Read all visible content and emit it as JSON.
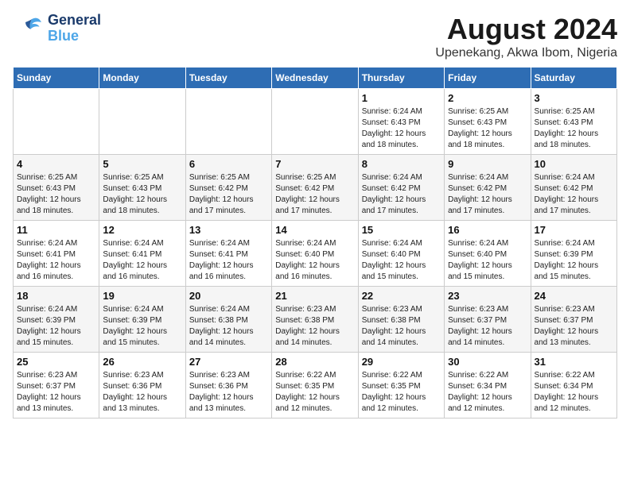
{
  "header": {
    "logo_general": "General",
    "logo_blue": "Blue",
    "month_title": "August 2024",
    "location": "Upenekang, Akwa Ibom, Nigeria"
  },
  "weekdays": [
    "Sunday",
    "Monday",
    "Tuesday",
    "Wednesday",
    "Thursday",
    "Friday",
    "Saturday"
  ],
  "weeks": [
    [
      {
        "day": "",
        "info": ""
      },
      {
        "day": "",
        "info": ""
      },
      {
        "day": "",
        "info": ""
      },
      {
        "day": "",
        "info": ""
      },
      {
        "day": "1",
        "sunrise": "6:24 AM",
        "sunset": "6:43 PM",
        "daylight": "12 hours and 18 minutes."
      },
      {
        "day": "2",
        "sunrise": "6:25 AM",
        "sunset": "6:43 PM",
        "daylight": "12 hours and 18 minutes."
      },
      {
        "day": "3",
        "sunrise": "6:25 AM",
        "sunset": "6:43 PM",
        "daylight": "12 hours and 18 minutes."
      }
    ],
    [
      {
        "day": "4",
        "sunrise": "6:25 AM",
        "sunset": "6:43 PM",
        "daylight": "12 hours and 18 minutes."
      },
      {
        "day": "5",
        "sunrise": "6:25 AM",
        "sunset": "6:43 PM",
        "daylight": "12 hours and 18 minutes."
      },
      {
        "day": "6",
        "sunrise": "6:25 AM",
        "sunset": "6:42 PM",
        "daylight": "12 hours and 17 minutes."
      },
      {
        "day": "7",
        "sunrise": "6:25 AM",
        "sunset": "6:42 PM",
        "daylight": "12 hours and 17 minutes."
      },
      {
        "day": "8",
        "sunrise": "6:24 AM",
        "sunset": "6:42 PM",
        "daylight": "12 hours and 17 minutes."
      },
      {
        "day": "9",
        "sunrise": "6:24 AM",
        "sunset": "6:42 PM",
        "daylight": "12 hours and 17 minutes."
      },
      {
        "day": "10",
        "sunrise": "6:24 AM",
        "sunset": "6:42 PM",
        "daylight": "12 hours and 17 minutes."
      }
    ],
    [
      {
        "day": "11",
        "sunrise": "6:24 AM",
        "sunset": "6:41 PM",
        "daylight": "12 hours and 16 minutes."
      },
      {
        "day": "12",
        "sunrise": "6:24 AM",
        "sunset": "6:41 PM",
        "daylight": "12 hours and 16 minutes."
      },
      {
        "day": "13",
        "sunrise": "6:24 AM",
        "sunset": "6:41 PM",
        "daylight": "12 hours and 16 minutes."
      },
      {
        "day": "14",
        "sunrise": "6:24 AM",
        "sunset": "6:40 PM",
        "daylight": "12 hours and 16 minutes."
      },
      {
        "day": "15",
        "sunrise": "6:24 AM",
        "sunset": "6:40 PM",
        "daylight": "12 hours and 15 minutes."
      },
      {
        "day": "16",
        "sunrise": "6:24 AM",
        "sunset": "6:40 PM",
        "daylight": "12 hours and 15 minutes."
      },
      {
        "day": "17",
        "sunrise": "6:24 AM",
        "sunset": "6:39 PM",
        "daylight": "12 hours and 15 minutes."
      }
    ],
    [
      {
        "day": "18",
        "sunrise": "6:24 AM",
        "sunset": "6:39 PM",
        "daylight": "12 hours and 15 minutes."
      },
      {
        "day": "19",
        "sunrise": "6:24 AM",
        "sunset": "6:39 PM",
        "daylight": "12 hours and 15 minutes."
      },
      {
        "day": "20",
        "sunrise": "6:24 AM",
        "sunset": "6:38 PM",
        "daylight": "12 hours and 14 minutes."
      },
      {
        "day": "21",
        "sunrise": "6:23 AM",
        "sunset": "6:38 PM",
        "daylight": "12 hours and 14 minutes."
      },
      {
        "day": "22",
        "sunrise": "6:23 AM",
        "sunset": "6:38 PM",
        "daylight": "12 hours and 14 minutes."
      },
      {
        "day": "23",
        "sunrise": "6:23 AM",
        "sunset": "6:37 PM",
        "daylight": "12 hours and 14 minutes."
      },
      {
        "day": "24",
        "sunrise": "6:23 AM",
        "sunset": "6:37 PM",
        "daylight": "12 hours and 13 minutes."
      }
    ],
    [
      {
        "day": "25",
        "sunrise": "6:23 AM",
        "sunset": "6:37 PM",
        "daylight": "12 hours and 13 minutes."
      },
      {
        "day": "26",
        "sunrise": "6:23 AM",
        "sunset": "6:36 PM",
        "daylight": "12 hours and 13 minutes."
      },
      {
        "day": "27",
        "sunrise": "6:23 AM",
        "sunset": "6:36 PM",
        "daylight": "12 hours and 13 minutes."
      },
      {
        "day": "28",
        "sunrise": "6:22 AM",
        "sunset": "6:35 PM",
        "daylight": "12 hours and 12 minutes."
      },
      {
        "day": "29",
        "sunrise": "6:22 AM",
        "sunset": "6:35 PM",
        "daylight": "12 hours and 12 minutes."
      },
      {
        "day": "30",
        "sunrise": "6:22 AM",
        "sunset": "6:34 PM",
        "daylight": "12 hours and 12 minutes."
      },
      {
        "day": "31",
        "sunrise": "6:22 AM",
        "sunset": "6:34 PM",
        "daylight": "12 hours and 12 minutes."
      }
    ]
  ],
  "labels": {
    "sunrise": "Sunrise:",
    "sunset": "Sunset:",
    "daylight": "Daylight:"
  }
}
